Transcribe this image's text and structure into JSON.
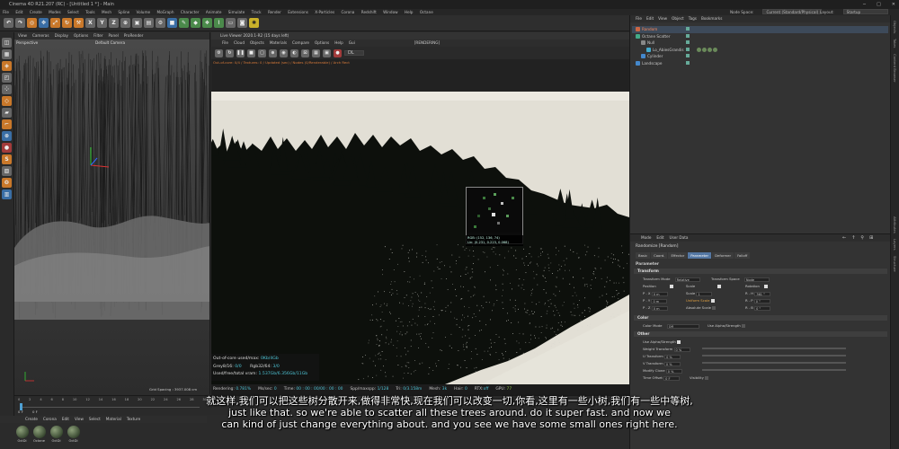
{
  "titlebar": {
    "title": "Cinema 4D R21.207 (RC) - [Untitled 1 *] - Main"
  },
  "menubar": {
    "items": [
      "File",
      "Edit",
      "Create",
      "Modes",
      "Select",
      "Tools",
      "Mesh",
      "Spline",
      "Volume",
      "MoGraph",
      "Character",
      "Animate",
      "Simulate",
      "Track",
      "Render",
      "Extensions",
      "X-Particles",
      "Corona",
      "Redshift",
      "Window",
      "Help",
      "Octane"
    ],
    "node_space_label": "Node Space:",
    "node_space_value": "Current (Standard/Physical)",
    "layout_label": "Layout:",
    "layout_value": "Startup"
  },
  "viewport": {
    "menu": [
      "View",
      "Cameras",
      "Display",
      "Options",
      "Filter",
      "Panel",
      "ProRender"
    ],
    "label": "Perspective",
    "camera": "Default Camera",
    "grid_spacing": "Grid Spacing : 3937.008 cm"
  },
  "liveviewer": {
    "title": "Live Viewer 2020.1-R2 (15 days left)",
    "menu": [
      "File",
      "Cloud",
      "Objects",
      "Materials",
      "Compare",
      "Options",
      "Help",
      "Gui"
    ],
    "state": "[RENDERING]",
    "warning": "Out-of-core: 0/4 / Textures: 0 / Updated (sec) / Nodes (0/Renderable) / Arch Rect",
    "mode": "DL",
    "picker_text_1": "RGB: (152, 136, 74)",
    "picker_text_2": "Lin: (0.231, 0.223, 0.068)",
    "info": {
      "line1_label": "Out-of-core used/max:",
      "line1_value": "0Kb/4Gb",
      "line2_label": "Grey8/16:",
      "line2_value": "0/0",
      "line2_label_b": "Rgb32/64:",
      "line2_value_b": "3/0",
      "line3_label": "Used/free/total vram:",
      "line3_value": "1.537Gb/6.356Gb/11Gb"
    },
    "status": {
      "rendering_label": "Rendering:",
      "rendering_value": "0.781%",
      "ms_label": "Ms/sec:",
      "ms_value": "0",
      "time_label": "Time:",
      "time_value": "00 : 00 : 00/00 : 00 : 00",
      "spp_label": "Spp/maxspp:",
      "spp_value": "1/128",
      "tri_label": "Tri:",
      "tri_value": "0/3.158m",
      "mesh_label": "Mesh:",
      "mesh_value": "3k",
      "hair_label": "Hair:",
      "hair_value": "0",
      "rtx_label": "RTX:",
      "rtx_value": "off",
      "gpu_label": "GPU:",
      "gpu_value": "77"
    }
  },
  "timeline": {
    "ticks": [
      "0",
      "2",
      "4",
      "6",
      "8",
      "10",
      "12",
      "14",
      "16",
      "18",
      "20",
      "22",
      "24",
      "26",
      "28",
      "30"
    ],
    "frame_a": "0 F",
    "frame_b": "0 F"
  },
  "materials": {
    "menu": [
      "Create",
      "Corona",
      "Edit",
      "View",
      "Select",
      "Material",
      "Texture"
    ],
    "items": [
      "OctDi",
      "Octane",
      "OctDi",
      "OctDi"
    ]
  },
  "subtitles": {
    "zh": "就这样,我们可以把这些树分散开来,做得非常快,现在我们可以改变一切,你看,这里有一些小树,我们有一些中等树,",
    "en1": "just like that. so we're able to scatter all these trees around. do it super fast. and now we",
    "en2": "can kind of just change everything about. and you see we have some small ones right here."
  },
  "object_manager": {
    "menu": [
      "File",
      "Edit",
      "View",
      "Object",
      "Tags",
      "Bookmarks"
    ],
    "items": [
      {
        "label": "Random",
        "selected": true
      },
      {
        "label": "Octane Scatter",
        "selected": false
      },
      {
        "label": "Null",
        "selected": false
      },
      {
        "label": "Lo_AbiesGrandis",
        "selected": false
      },
      {
        "label": "Cylinder",
        "selected": false
      },
      {
        "label": "Landscape",
        "selected": false
      }
    ]
  },
  "attribute_manager": {
    "menu": [
      "Mode",
      "Edit",
      "User Data"
    ],
    "title": "Randomize [Random]",
    "tabs": [
      "Basic",
      "Coord.",
      "Effector",
      "Parameter",
      "Deformer",
      "Falloff"
    ],
    "active_tab": "Parameter",
    "section_parameter": "Parameter",
    "section_transform": "Transform",
    "section_color": "Color",
    "section_other": "Other",
    "transform_mode_label": "Transform Mode",
    "transform_mode_value": "Relative",
    "transform_space_label": "Transform Space",
    "transform_space_value": "Node",
    "position_label": "Position",
    "scale_label": "Scale",
    "rotation_label": "Rotation",
    "px_label": "P . X",
    "px_value": "0 m",
    "py_label": "P . Y",
    "py_value": "0 m",
    "pz_label": "P . Z",
    "pz_value": "0 m",
    "scale_value_label": "Scale",
    "scale_value": "1",
    "uniform_scale_label": "Uniform Scale",
    "absolute_scale_label": "Absolute Scale",
    "rh_label": "R . H",
    "rh_value": "361 °",
    "rp_label": "R . P",
    "rp_value": "0 °",
    "rb_label": "R . B",
    "rb_value": "0 °",
    "color_mode_label": "Color Mode",
    "color_mode_value": "Off",
    "use_alpha_strength_label": "Use Alpha/Strength",
    "other_use_alpha_label": "Use Alpha/Strength",
    "weight_transform_label": "Weight Transform",
    "weight_transform_value": "0 %",
    "u_transform_label": "U Transform",
    "u_transform_value": "0 %",
    "v_transform_label": "V Transform",
    "v_transform_value": "0 %",
    "modify_clone_label": "Modify Clone",
    "modify_clone_value": "0 %",
    "time_offset_label": "Time Offset",
    "time_offset_value": "0 F",
    "visibility_label": "Visibility"
  },
  "right_strip": [
    "Objects",
    "Takes",
    "Content Browser",
    "Attributes",
    "Layers",
    "Structure"
  ],
  "colors": {
    "accent": "#5477a3",
    "cyan": "#4ec3d4",
    "warn": "#d77a3a"
  }
}
